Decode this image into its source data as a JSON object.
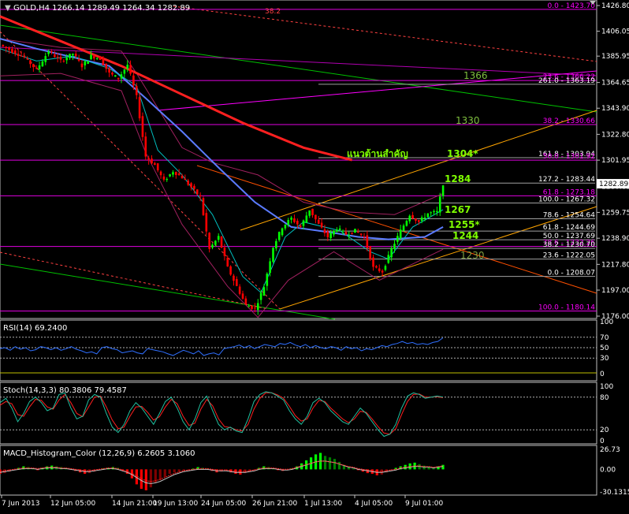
{
  "header": {
    "main": "GOLD,H4  1266.14 1289.49 1264.34 1282.89",
    "rsi": "RSI(14) 69.2400",
    "stoch": "Stoch(14,3,3) 80.3806 79.4587",
    "macd": "MACD_Histogram_Color (12,26,9)  6.2605 3.1060"
  },
  "colors": {
    "background": "#000000",
    "frame": "#c0c0c0",
    "bull": "#00ff00",
    "bear": "#ff0000",
    "ma_fast": "#00bfbf",
    "ma_mid": "#5b7bff",
    "ma_slow": "#ff2020",
    "bollinger": "#a0205f",
    "fib": "#ff00ff",
    "label_green": "#7fff00",
    "channel": "#ffa500"
  },
  "price_axis": {
    "ticks": [
      "1426.80",
      "1406.05",
      "1385.95",
      "1364.65",
      "1343.90",
      "1322.80",
      "1301.95",
      "1280.85",
      "1259.75",
      "1238.90",
      "1217.80",
      "1197.00",
      "1176.00"
    ],
    "current": "1282.89"
  },
  "rsi_axis": [
    "100",
    "70",
    "50",
    "30",
    "0"
  ],
  "stoch_axis": [
    "100",
    "80",
    "20",
    "0"
  ],
  "macd_axis": [
    "26.73",
    "0.00",
    "-30.1315"
  ],
  "time_axis": [
    "7 Jun 2013",
    "12 Jun 05:00",
    "14 Jun 21:00",
    "19 Jun 13:00",
    "24 Jun 05:00",
    "26 Jun 21:00",
    "1 Jul 13:00",
    "4 Jul 05:00",
    "9 Jul 01:00"
  ],
  "annotations": {
    "top_38": "38.2",
    "lvl_1366": "1366",
    "lvl_1330": "1330",
    "resistance_thai": "แนวต้านสำคัญ",
    "lvl_1304": "1304*",
    "lvl_1284": "1284",
    "lvl_1267": "1267",
    "lvl_1255": "1255*",
    "lvl_1244": "1244",
    "lvl_1230": "1230"
  },
  "fib_labels": [
    {
      "text": "0.0 - 1423.70",
      "price": 1423.7,
      "color": "#ff00ff"
    },
    {
      "text": "23.6 - 1366.22",
      "price": 1366.22,
      "color": "#ff00ff"
    },
    {
      "text": "261.0 - 1363.19",
      "price": 1363.19,
      "color": "#ffffff"
    },
    {
      "text": "38.2 - 1330.66",
      "price": 1330.66,
      "color": "#ff00ff"
    },
    {
      "text": "161.8 - 1303.94",
      "price": 1303.94,
      "color": "#ffffff"
    },
    {
      "text": "50.0 - 1301.92",
      "price": 1301.92,
      "color": "#ff00ff"
    },
    {
      "text": "127.2 - 1283.44",
      "price": 1283.44,
      "color": "#ffffff"
    },
    {
      "text": "61.8 - 1273.18",
      "price": 1273.18,
      "color": "#ff00ff"
    },
    {
      "text": "100.0 - 1267.32",
      "price": 1267.32,
      "color": "#ffffff"
    },
    {
      "text": "78.6 - 1254.64",
      "price": 1254.64,
      "color": "#ffffff"
    },
    {
      "text": "61.8 - 1244.69",
      "price": 1244.69,
      "color": "#ffffff"
    },
    {
      "text": "50.0 - 1237.69",
      "price": 1237.69,
      "color": "#ffffff"
    },
    {
      "text": "78.6 - 1232.26",
      "price": 1232.26,
      "color": "#ff00ff"
    },
    {
      "text": "38.2 - 1230.70",
      "price": 1230.7,
      "color": "#ffffff"
    },
    {
      "text": "23.6 - 1222.05",
      "price": 1222.05,
      "color": "#ffffff"
    },
    {
      "text": "0.0 - 1208.07",
      "price": 1208.07,
      "color": "#ffffff"
    },
    {
      "text": "100.0 - 1180.14",
      "price": 1180.14,
      "color": "#ff00ff"
    }
  ],
  "chart_data": [
    {
      "type": "candlestick",
      "symbol": "GOLD",
      "timeframe": "H4",
      "ohlc_last": {
        "open": 1266.14,
        "high": 1289.49,
        "low": 1264.34,
        "close": 1282.89
      },
      "ylim": [
        1176.0,
        1426.8
      ],
      "x_labels": [
        "7 Jun 2013",
        "12 Jun 05:00",
        "14 Jun 21:00",
        "19 Jun 13:00",
        "24 Jun 05:00",
        "26 Jun 21:00",
        "1 Jul 13:00",
        "4 Jul 05:00",
        "9 Jul 01:00"
      ],
      "price_path": [
        [
          0,
          1395
        ],
        [
          8,
          1385
        ],
        [
          12,
          1375
        ],
        [
          16,
          1390
        ],
        [
          20,
          1382
        ],
        [
          24,
          1388
        ],
        [
          27,
          1378
        ],
        [
          30,
          1386
        ],
        [
          33,
          1384
        ],
        [
          36,
          1372
        ],
        [
          39,
          1368
        ],
        [
          42,
          1379
        ],
        [
          45,
          1353
        ],
        [
          48,
          1305
        ],
        [
          51,
          1298
        ],
        [
          54,
          1285
        ],
        [
          57,
          1293
        ],
        [
          60,
          1288
        ],
        [
          63,
          1280
        ],
        [
          66,
          1272
        ],
        [
          69,
          1230
        ],
        [
          72,
          1240
        ],
        [
          75,
          1215
        ],
        [
          78,
          1200
        ],
        [
          81,
          1185
        ],
        [
          84,
          1182
        ],
        [
          87,
          1200
        ],
        [
          90,
          1232
        ],
        [
          93,
          1248
        ],
        [
          96,
          1255
        ],
        [
          99,
          1248
        ],
        [
          102,
          1262
        ],
        [
          105,
          1250
        ],
        [
          108,
          1240
        ],
        [
          111,
          1247
        ],
        [
          114,
          1242
        ],
        [
          117,
          1245
        ],
        [
          120,
          1240
        ],
        [
          123,
          1215
        ],
        [
          126,
          1212
        ],
        [
          129,
          1230
        ],
        [
          132,
          1245
        ],
        [
          135,
          1258
        ],
        [
          138,
          1252
        ],
        [
          141,
          1259
        ],
        [
          144,
          1260
        ],
        [
          146,
          1283
        ]
      ],
      "bollinger_upper": [
        [
          0,
          1400
        ],
        [
          20,
          1393
        ],
        [
          40,
          1390
        ],
        [
          45,
          1372
        ],
        [
          60,
          1312
        ],
        [
          70,
          1300
        ],
        [
          85,
          1290
        ],
        [
          100,
          1268
        ],
        [
          115,
          1260
        ],
        [
          130,
          1258
        ],
        [
          146,
          1275
        ]
      ],
      "bollinger_lower": [
        [
          0,
          1370
        ],
        [
          20,
          1372
        ],
        [
          40,
          1358
        ],
        [
          48,
          1308
        ],
        [
          60,
          1250
        ],
        [
          75,
          1200
        ],
        [
          85,
          1175
        ],
        [
          95,
          1205
        ],
        [
          110,
          1228
        ],
        [
          125,
          1205
        ],
        [
          146,
          1230
        ]
      ],
      "ma_fast": [
        [
          0,
          1392
        ],
        [
          12,
          1382
        ],
        [
          24,
          1386
        ],
        [
          36,
          1376
        ],
        [
          45,
          1362
        ],
        [
          52,
          1310
        ],
        [
          60,
          1290
        ],
        [
          70,
          1258
        ],
        [
          80,
          1208
        ],
        [
          86,
          1195
        ],
        [
          94,
          1240
        ],
        [
          100,
          1252
        ],
        [
          112,
          1245
        ],
        [
          122,
          1228
        ],
        [
          128,
          1222
        ],
        [
          136,
          1248
        ],
        [
          146,
          1262
        ]
      ],
      "ma_mid": [
        [
          0,
          1400
        ],
        [
          12,
          1392
        ],
        [
          24,
          1385
        ],
        [
          36,
          1378
        ],
        [
          48,
          1352
        ],
        [
          60,
          1325
        ],
        [
          72,
          1296
        ],
        [
          84,
          1268
        ],
        [
          96,
          1248
        ],
        [
          108,
          1244
        ],
        [
          118,
          1240
        ],
        [
          128,
          1238
        ],
        [
          140,
          1240
        ],
        [
          146,
          1248
        ]
      ],
      "ma_slow": [
        [
          0,
          1418
        ],
        [
          20,
          1398
        ],
        [
          40,
          1378
        ],
        [
          60,
          1355
        ],
        [
          80,
          1332
        ],
        [
          100,
          1312
        ],
        [
          116,
          1302
        ]
      ]
    },
    {
      "type": "line",
      "name": "RSI(14)",
      "ylim": [
        0,
        100
      ],
      "levels": [
        70,
        50,
        30
      ],
      "last": 69.24,
      "values": [
        48,
        50,
        45,
        52,
        47,
        50,
        44,
        46,
        52,
        50,
        46,
        50,
        45,
        48,
        52,
        47,
        44,
        40,
        42,
        38,
        50,
        52,
        48,
        46,
        40,
        42,
        44,
        40,
        38,
        48,
        46,
        44,
        42,
        38,
        35,
        40,
        45,
        42,
        38,
        44,
        35,
        38,
        40,
        36,
        48,
        50,
        52,
        55,
        50,
        54,
        48,
        52,
        56,
        54,
        52,
        58,
        56,
        60,
        55,
        52,
        56,
        50,
        54,
        50,
        48,
        52,
        50,
        45,
        52,
        48,
        50,
        44,
        48,
        46,
        50,
        54,
        52,
        56,
        58,
        62,
        58,
        60,
        56,
        58,
        56,
        60,
        62,
        69
      ]
    },
    {
      "type": "line",
      "name": "Stoch(14,3,3)",
      "ylim": [
        0,
        100
      ],
      "levels": [
        80,
        20
      ],
      "last_main": 80.3806,
      "last_signal": 79.4587,
      "main": [
        70,
        78,
        60,
        35,
        50,
        72,
        80,
        70,
        55,
        60,
        85,
        88,
        60,
        40,
        45,
        75,
        85,
        80,
        50,
        25,
        15,
        30,
        55,
        70,
        60,
        45,
        30,
        50,
        72,
        80,
        60,
        35,
        20,
        40,
        70,
        82,
        55,
        30,
        20,
        25,
        18,
        15,
        40,
        72,
        85,
        90,
        88,
        82,
        75,
        55,
        40,
        30,
        45,
        70,
        78,
        70,
        55,
        45,
        35,
        30,
        45,
        60,
        50,
        35,
        20,
        8,
        12,
        30,
        60,
        82,
        88,
        85,
        78,
        80,
        82,
        80
      ],
      "signal": [
        65,
        72,
        68,
        48,
        45,
        62,
        76,
        74,
        62,
        58,
        75,
        85,
        70,
        50,
        44,
        62,
        80,
        82,
        62,
        38,
        22,
        25,
        45,
        62,
        63,
        52,
        38,
        44,
        62,
        76,
        68,
        45,
        28,
        32,
        58,
        76,
        64,
        40,
        26,
        24,
        20,
        18,
        30,
        58,
        78,
        88,
        88,
        84,
        78,
        63,
        46,
        36,
        40,
        60,
        74,
        72,
        60,
        50,
        40,
        33,
        40,
        54,
        52,
        40,
        26,
        14,
        12,
        22,
        48,
        72,
        85,
        86,
        80,
        80,
        81,
        79
      ]
    },
    {
      "type": "bar",
      "name": "MACD_Histogram_Color (12,26,9)",
      "ylim": [
        -30.1315,
        26.73
      ],
      "last_macd": 6.2605,
      "last_signal": 3.106,
      "histogram": [
        -6,
        -5,
        -3,
        -1,
        2,
        4,
        3,
        1,
        -1,
        2,
        4,
        5,
        4,
        3,
        2,
        1,
        -2,
        -4,
        -6,
        -5,
        -3,
        -1,
        1,
        2,
        3,
        2,
        -2,
        -6,
        -12,
        -20,
        -26,
        -28,
        -24,
        -18,
        -14,
        -10,
        -6,
        -4,
        -3,
        -2,
        -1,
        1,
        3,
        2,
        1,
        -2,
        -4,
        -3,
        -2,
        -4,
        -6,
        -7,
        -5,
        -3,
        -1,
        2,
        4,
        3,
        1,
        -1,
        -2,
        -1,
        1,
        4,
        8,
        12,
        16,
        20,
        22,
        18,
        16,
        14,
        10,
        6,
        3,
        1,
        -1,
        -3,
        -5,
        -6,
        -8,
        -7,
        -4,
        -1,
        2,
        4,
        6,
        8,
        9,
        7,
        5,
        3,
        2,
        4,
        6
      ],
      "signal_line": [
        -4,
        -3,
        -2,
        -1,
        0,
        1,
        1,
        1,
        0,
        1,
        2,
        2,
        2,
        1,
        1,
        0,
        -1,
        -2,
        -3,
        -3,
        -2,
        -1,
        0,
        1,
        1,
        0,
        -2,
        -4,
        -7,
        -11,
        -15,
        -18,
        -19,
        -18,
        -16,
        -13,
        -10,
        -7,
        -5,
        -3,
        -2,
        -1,
        0,
        0,
        0,
        -1,
        -2,
        -2,
        -2,
        -3,
        -4,
        -4,
        -4,
        -3,
        -2,
        0,
        1,
        1,
        1,
        0,
        -1,
        -1,
        0,
        2,
        4,
        6,
        8,
        10,
        11,
        11,
        10,
        9,
        7,
        5,
        3,
        2,
        0,
        -1,
        -2,
        -3,
        -4,
        -4,
        -3,
        -2,
        -1,
        1,
        2,
        3,
        4,
        4,
        3,
        3,
        2,
        3,
        4
      ]
    }
  ]
}
